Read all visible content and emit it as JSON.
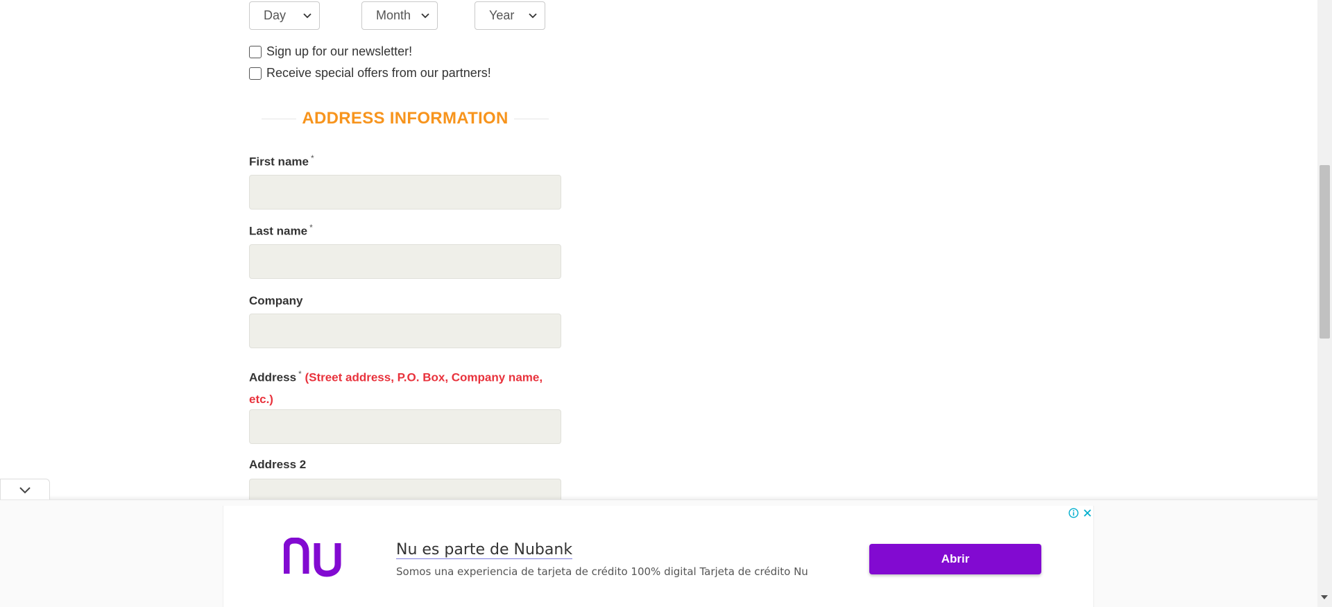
{
  "birth_date": {
    "day_label": "Day",
    "month_label": "Month",
    "year_label": "Year"
  },
  "options": {
    "newsletter_label": "Sign up for our newsletter!",
    "offers_label": "Receive special offers from our partners!"
  },
  "address_section": {
    "title": "ADDRESS INFORMATION",
    "first_name_label": "First name",
    "last_name_label": "Last name",
    "company_label": "Company",
    "address_label": "Address",
    "address_note": "(Street address, P.O. Box, Company name,",
    "address_note_cont": "etc.)",
    "address2_label": "Address 2",
    "required_mark": "*"
  },
  "ad": {
    "headline": "Nu es parte de Nubank",
    "description": "Somos una experiencia de tarjeta de crédito 100% digital Tarjeta de crédito Nu",
    "button_label": "Abrir",
    "brand": "nu",
    "button_color": "#820ad1",
    "icons": [
      "info-icon",
      "close-icon",
      "chevron-down-icon"
    ]
  },
  "colors": {
    "section_title": "#f7941d",
    "required_note": "#e8323c",
    "input_bg": "#efefe9"
  }
}
